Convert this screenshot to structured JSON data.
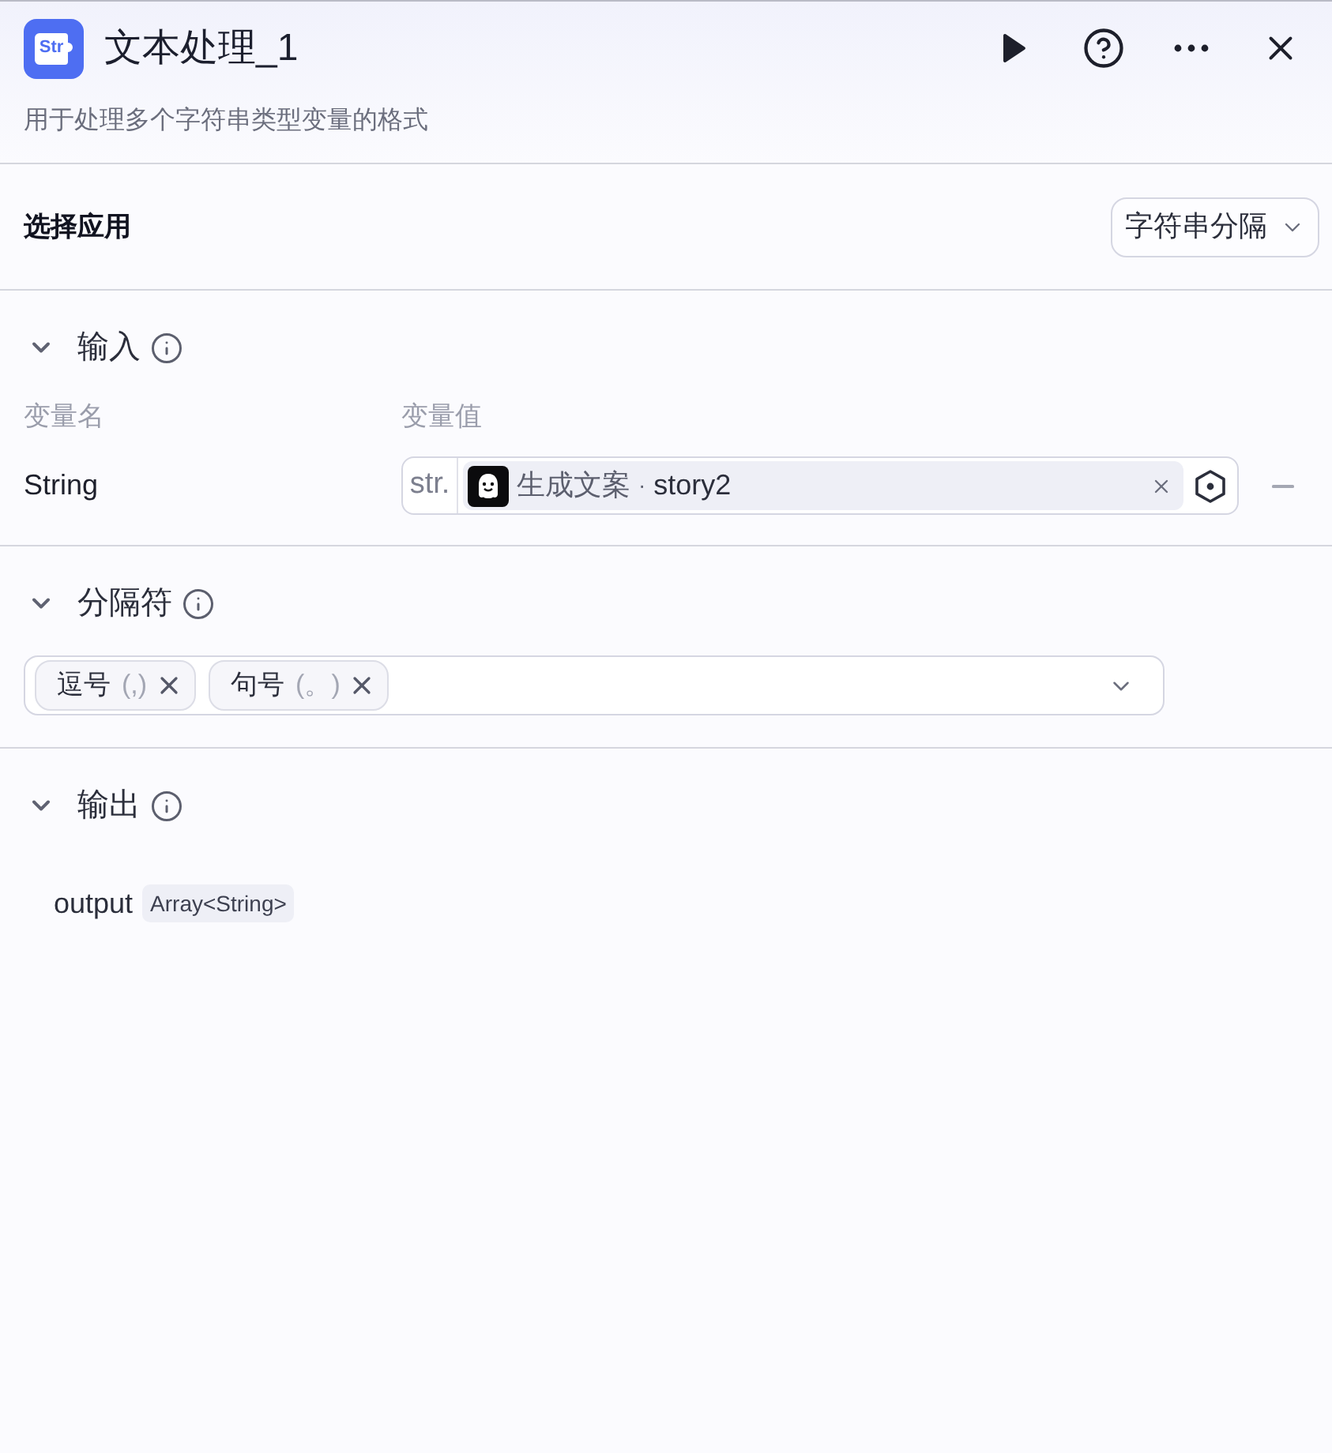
{
  "header": {
    "icon_text": "Str",
    "title": "文本处理_1",
    "description": "用于处理多个字符串类型变量的格式"
  },
  "app_select": {
    "label": "选择应用",
    "value": "字符串分隔"
  },
  "input_section": {
    "title": "输入",
    "expanded": true,
    "columns": [
      "变量名",
      "变量值"
    ],
    "rows": [
      {
        "name": "String",
        "type_prefix": "str.",
        "source": "生成文案",
        "separator": "·",
        "variable": "story2"
      }
    ]
  },
  "separator_section": {
    "title": "分隔符",
    "expanded": true,
    "tags": [
      {
        "label": "逗号",
        "symbol": "(,)"
      },
      {
        "label": "句号",
        "symbol": "(。)"
      }
    ]
  },
  "output_section": {
    "title": "输出",
    "expanded": true,
    "outputs": [
      {
        "name": "output",
        "type": "Array<String>"
      }
    ]
  }
}
